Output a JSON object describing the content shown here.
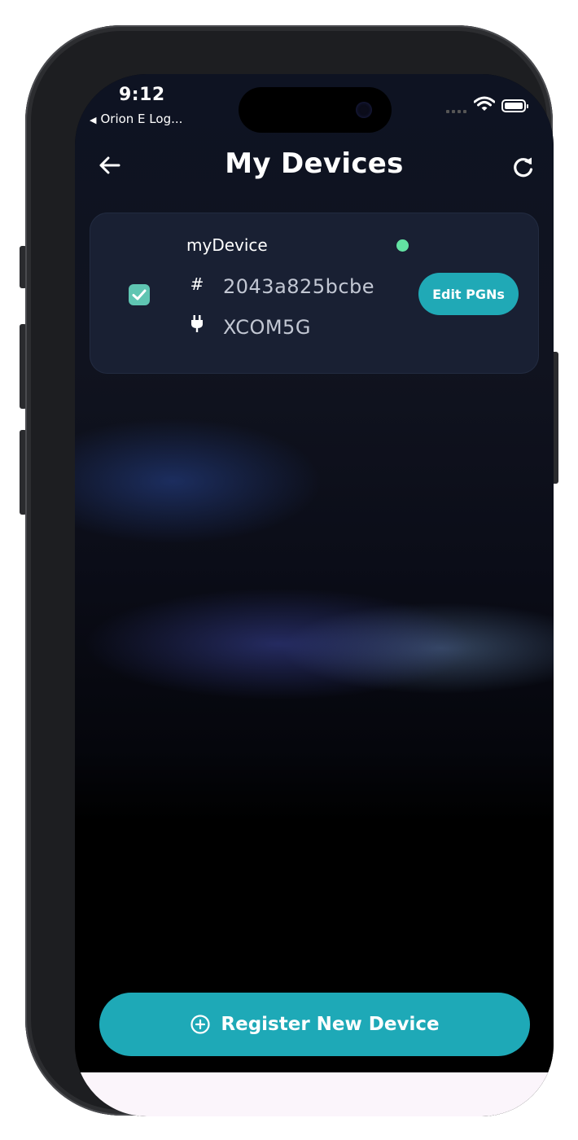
{
  "status_bar": {
    "time": "9:12",
    "back_app_label": "Orion E Log..."
  },
  "header": {
    "title": "My Devices",
    "back_icon": "arrow-left-icon",
    "refresh_icon": "refresh-icon"
  },
  "devices": [
    {
      "name": "myDevice",
      "selected": true,
      "online": true,
      "id": "2043a825bcbe",
      "model": "XCOM5G",
      "action_label": "Edit PGNs"
    }
  ],
  "footer": {
    "register_label": "Register New Device",
    "register_icon": "plus-circle-icon"
  },
  "colors": {
    "accent": "#1ea9b7",
    "checkbox": "#5fc5b2",
    "online": "#63e2a3",
    "card": "#192033"
  }
}
